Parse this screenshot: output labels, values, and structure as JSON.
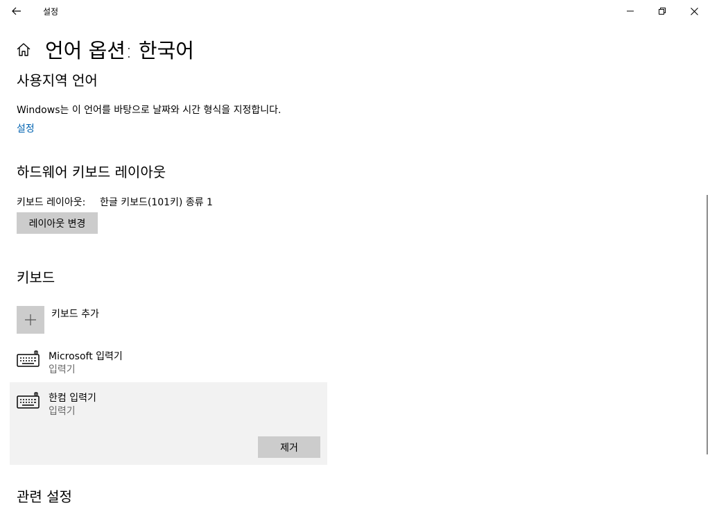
{
  "window": {
    "title": "설정"
  },
  "header": {
    "page_title": "언어 옵션: 한국어"
  },
  "regional": {
    "title": "사용지역 언어",
    "description": "Windows는 이 언어를 바탕으로 날짜와 시간 형식을 지정합니다.",
    "settings_link": "설정"
  },
  "hardware_keyboard": {
    "title": "하드웨어 키보드 레이아웃",
    "layout_label": "키보드 레이아웃:",
    "layout_value": "한글 키보드(101키) 종류 1",
    "change_button": "레이아웃 변경"
  },
  "keyboards": {
    "title": "키보드",
    "add_label": "키보드 추가",
    "items": [
      {
        "name": "Microsoft 입력기",
        "type": "입력기",
        "selected": false
      },
      {
        "name": "한컴 입력기",
        "type": "입력기",
        "selected": true
      }
    ],
    "remove_button": "제거"
  },
  "related": {
    "title": "관련 설정"
  },
  "icons": {
    "back": "back-arrow-icon",
    "home": "home-icon",
    "minimize": "minimize-icon",
    "maximize": "restore-icon",
    "close": "close-icon",
    "add": "plus-icon",
    "keyboard": "keyboard-icon"
  },
  "colors": {
    "link": "#0063b1",
    "button_bg": "#cccccc",
    "selected_bg": "#f2f2f2",
    "secondary_text": "#666666"
  }
}
